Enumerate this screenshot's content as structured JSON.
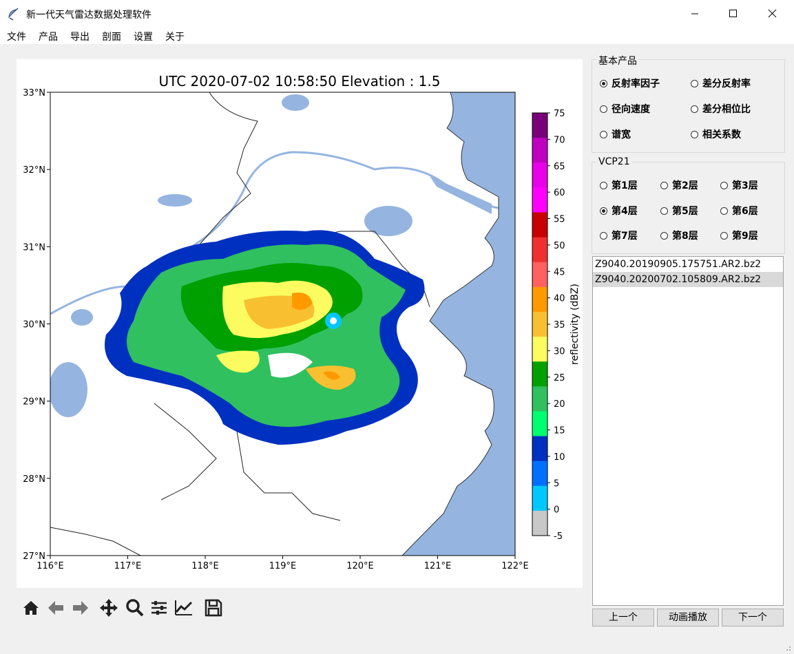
{
  "window": {
    "title": "新一代天气雷达数据处理软件",
    "controls": [
      "—",
      "☐",
      "✕"
    ]
  },
  "menu": [
    "文件",
    "产品",
    "导出",
    "剖面",
    "设置",
    "关于"
  ],
  "plot": {
    "title": "UTC 2020-07-02 10:58:50 Elevation : 1.5",
    "lon_ticks": [
      "116°E",
      "117°E",
      "118°E",
      "119°E",
      "120°E",
      "121°E",
      "122°E"
    ],
    "lat_ticks": [
      "33°N",
      "32°N",
      "31°N",
      "30°N",
      "29°N",
      "28°N",
      "27°N"
    ],
    "colorbar": {
      "label": "reflectivity (dBZ)",
      "ticks": [
        "75",
        "70",
        "65",
        "60",
        "55",
        "50",
        "45",
        "40",
        "35",
        "30",
        "25",
        "20",
        "15",
        "10",
        "5",
        "0",
        "-5"
      ],
      "colors": [
        "#7a007a",
        "#c000c0",
        "#e800e8",
        "#ff00ff",
        "#c80000",
        "#f03030",
        "#ff6060",
        "#ff9900",
        "#f8c030",
        "#fcfc60",
        "#00a000",
        "#30c060",
        "#00ff70",
        "#0030c0",
        "#0070ff",
        "#00c8ff",
        "#c8c8c8"
      ]
    }
  },
  "toolbar": [
    "home-icon",
    "back-icon",
    "forward-icon",
    "pan-icon",
    "zoom-icon",
    "configure-subplots-icon",
    "edit-axis-icon",
    "save-icon"
  ],
  "basic_products": {
    "title": "基本产品",
    "options": [
      {
        "label": "反射率因子",
        "checked": true
      },
      {
        "label": "差分反射率",
        "checked": false
      },
      {
        "label": "径向速度",
        "checked": false
      },
      {
        "label": "差分相位比",
        "checked": false
      },
      {
        "label": "谱宽",
        "checked": false
      },
      {
        "label": "相关系数",
        "checked": false
      }
    ]
  },
  "vcp": {
    "title": "VCP21",
    "layers": [
      {
        "label": "第1层",
        "checked": false
      },
      {
        "label": "第2层",
        "checked": false
      },
      {
        "label": "第3层",
        "checked": false
      },
      {
        "label": "第4层",
        "checked": true
      },
      {
        "label": "第5层",
        "checked": false
      },
      {
        "label": "第6层",
        "checked": false
      },
      {
        "label": "第7层",
        "checked": false
      },
      {
        "label": "第8层",
        "checked": false
      },
      {
        "label": "第9层",
        "checked": false
      }
    ]
  },
  "files": {
    "items": [
      "Z9040.20190905.175751.AR2.bz2",
      "Z9040.20200702.105809.AR2.bz2"
    ],
    "selected_index": 1
  },
  "buttons": {
    "prev": "上一个",
    "animate": "动画播放",
    "next": "下一个"
  }
}
